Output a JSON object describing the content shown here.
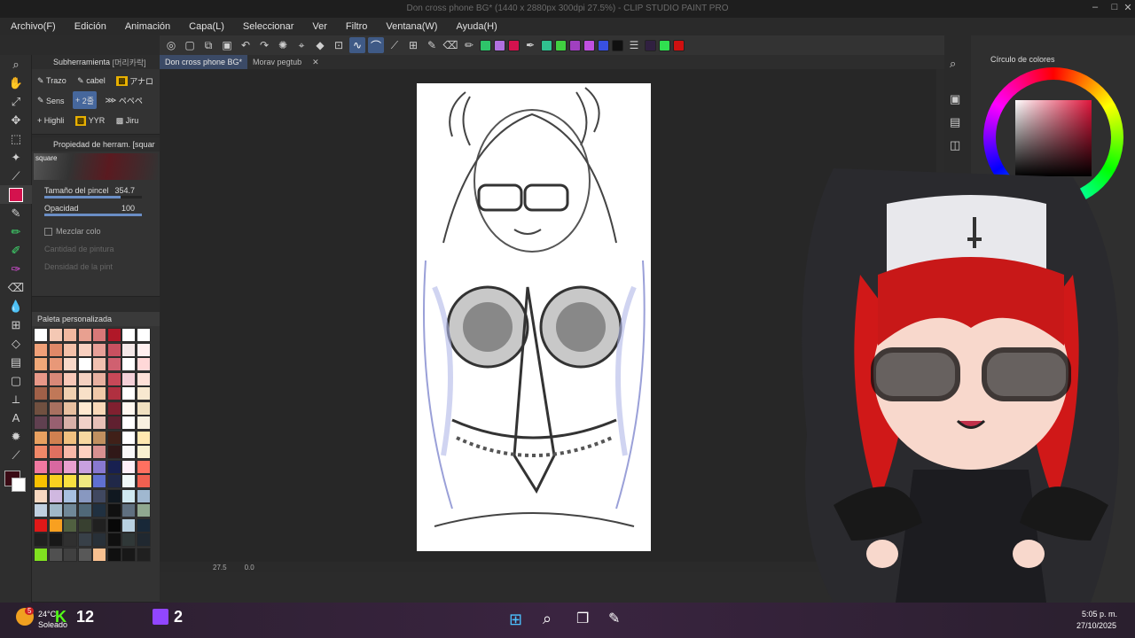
{
  "window": {
    "title": "Don cross phone BG* (1440 x 2880px 300dpi 27.5%) - CLIP STUDIO PAINT PRO"
  },
  "menu": [
    "Archivo(F)",
    "Edición",
    "Animación",
    "Capa(L)",
    "Seleccionar",
    "Ver",
    "Filtro",
    "Ventana(W)",
    "Ayuda(H)"
  ],
  "subtool_panel": {
    "header": "Subherramienta",
    "header_extra": "[머리카락]",
    "tools": [
      "Trazo",
      "cabel",
      "アナロ",
      "Sens",
      "2줄",
      "ペペペ",
      "Highli",
      "YYR",
      "Jiru"
    ]
  },
  "tool_property": {
    "header": "Propiedad de herram. [squar",
    "brush_name": "square",
    "brush_size_label": "Tamaño del pincel",
    "brush_size_value": "354.7",
    "brush_size_fill": 0.78,
    "opacity_label": "Opacidad",
    "opacity_value": "100",
    "opacity_fill": 1.0,
    "blend_label": "Mezclar colo",
    "paint_amount_label": "Cantidad de pintura",
    "paint_density_label": "Densidad de la pint"
  },
  "palette": {
    "name": "Paleta personalizada",
    "swatches": [
      "#ffffff",
      "#f4c8b4",
      "#f0b8a0",
      "#e8a090",
      "#d87878",
      "#b01828",
      "#ffffff",
      "#ffffff",
      "#f0a078",
      "#e08868",
      "#f4c0a8",
      "#f8d0c0",
      "#e8a098",
      "#c85060",
      "#f4e8e8",
      "#fff0f0",
      "#f0a878",
      "#e89878",
      "#f8d8c8",
      "#ffffff",
      "#f0c0b0",
      "#d06070",
      "#ffffff",
      "#ffd8d8",
      "#e89888",
      "#d88878",
      "#f8c8b8",
      "#f4d0c0",
      "#e8b0a0",
      "#c84858",
      "#f4d0d8",
      "#ffe0d8",
      "#a06048",
      "#c07858",
      "#f0d0b0",
      "#f8e0c8",
      "#f0c8a8",
      "#b03040",
      "#ffffff",
      "#f8e8d0",
      "#705040",
      "#a87060",
      "#e8c0a0",
      "#ffe8d0",
      "#f8d8b8",
      "#802030",
      "#fff8f0",
      "#f0e0c0",
      "#604050",
      "#986070",
      "#d8b0a8",
      "#f0d0c8",
      "#e8c0b8",
      "#602030",
      "#ffffff",
      "#f8f0e0",
      "#e8a060",
      "#d08050",
      "#f0c080",
      "#f8d8a0",
      "#c09060",
      "#402018",
      "#ffffff",
      "#ffe8b0",
      "#f08868",
      "#e07060",
      "#f8b8a8",
      "#ffd0c0",
      "#d89090",
      "#301818",
      "#f8f8f8",
      "#f8f0d0",
      "#f078a0",
      "#d868a0",
      "#e8a0d0",
      "#c8a0e0",
      "#8878d0",
      "#182050",
      "#fff0f8",
      "#ff7060",
      "#f8c000",
      "#f8d020",
      "#f8e040",
      "#f0e880",
      "#6070d0",
      "#202848",
      "#f0f8f8",
      "#f06050",
      "#f8d8c0",
      "#d0b8e0",
      "#a8c0e0",
      "#8898c0",
      "#404860",
      "#101820",
      "#d0e8f0",
      "#a0b8d0",
      "#c0d0e0",
      "#a0b8c8",
      "#708898",
      "#506878",
      "#203040",
      "#101010",
      "#607080",
      "#90a890",
      "#e01818",
      "#f8a020",
      "#506040",
      "#384030",
      "#202020",
      "#080808",
      "#b8d0e0",
      "#182838",
      "#202020",
      "#181818",
      "#303030",
      "#384048",
      "#283038",
      "#101010",
      "#303838",
      "#202830",
      "#80e020",
      "#505050",
      "#404040",
      "#585858",
      "#f8c090",
      "#101010",
      "#181818",
      "#202020"
    ]
  },
  "tabs": [
    "Don cross phone BG*",
    "Morav pegtub"
  ],
  "status": {
    "zoom": "27.5",
    "angle": "0.0"
  },
  "right_panel": {
    "color_wheel_label": "Círculo de colores"
  },
  "taskbar": {
    "weather_temp": "24°C",
    "weather_text": "Soleado",
    "weather_badge": "5",
    "app1_count": "12",
    "twitch_count": "2",
    "time": "5:05 p. m.",
    "date": "27/10/2025"
  },
  "colors": {
    "main_color": "#d4124e",
    "accent": "#46679c"
  }
}
